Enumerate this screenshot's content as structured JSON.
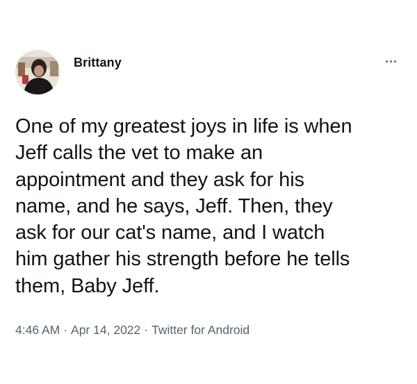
{
  "author": {
    "name": "Brittany"
  },
  "more_icon": "more-horizontal-icon",
  "tweet": {
    "lines": [
      "One of my greatest joys in life is when",
      "Jeff calls the vet to make an",
      "appointment and they ask for his",
      "name, and he says, Jeff. Then, they",
      "ask for our cat's name, and I watch",
      "him gather his strength before he tells",
      "them, Baby Jeff."
    ]
  },
  "meta": {
    "time": "4:46 AM",
    "separator": "·",
    "date": "Apr 14, 2022",
    "source": "Twitter for Android"
  }
}
